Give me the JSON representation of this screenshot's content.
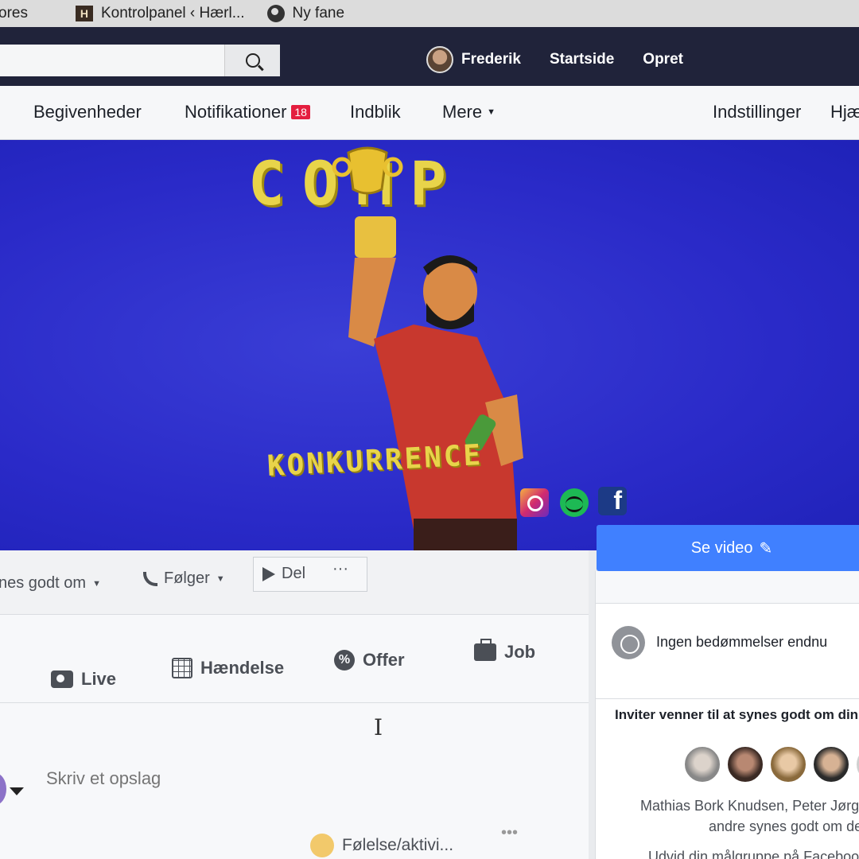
{
  "bookmarks": [
    {
      "label": "ores",
      "icon": "none"
    },
    {
      "label": "Kontrolpanel ‹ Hærl...",
      "icon": "site-h-icon"
    },
    {
      "label": "Ny fane",
      "icon": "globe-icon"
    }
  ],
  "topbar": {
    "search_placeholder": "",
    "user_name": "Frederik",
    "home": "Startside",
    "create": "Opret"
  },
  "page_nav": {
    "events": "Begivenheder",
    "notifications": "Notifikationer",
    "notifications_count": "18",
    "insights": "Indblik",
    "more": "Mere",
    "settings": "Indstillinger",
    "help": "Hjæ"
  },
  "cover": {
    "title": "COMP",
    "subtitle": "KONKURRENCE",
    "colors": {
      "background": "#2a2ac8",
      "text": "#e8d44a"
    }
  },
  "actions": {
    "like": "nes godt om",
    "follow": "Følger",
    "share": "Del",
    "more": "···"
  },
  "see_video": "Se video",
  "composer": {
    "live": "Live",
    "event": "Hændelse",
    "offer": "Offer",
    "job": "Job",
    "placeholder": "Skriv et opslag",
    "feeling": "Følelse/aktivi...",
    "more": "•••"
  },
  "right": {
    "rating": "Ingen bedømmelser endnu",
    "invite_title": "Inviter venner til at synes godt om din s",
    "invite_names": "Mathias Bork Knudsen, Peter Jørge",
    "invite_more": "andre synes godt om de",
    "expand": "Udvid din målgruppe på Faceboo"
  }
}
